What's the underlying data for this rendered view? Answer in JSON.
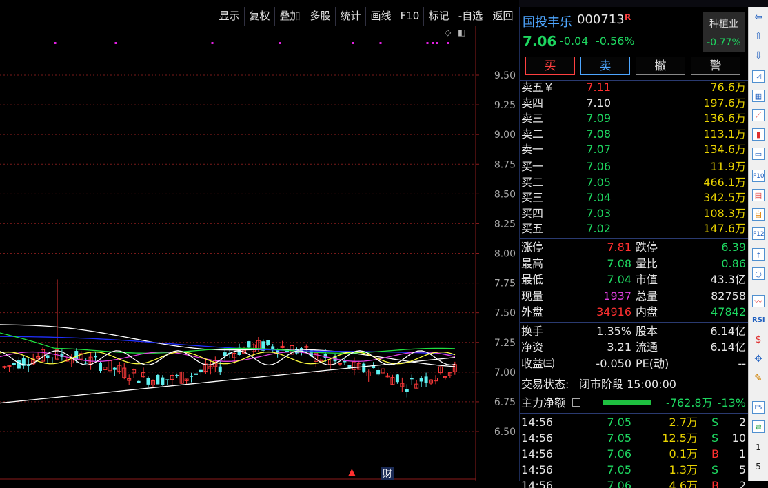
{
  "toolbar": {
    "buttons": [
      "显示",
      "复权",
      "叠加",
      "多股",
      "统计",
      "画线",
      "F10",
      "标记",
      "-自选",
      "返回"
    ]
  },
  "chart": {
    "y_ticks": [
      "9.50",
      "9.25",
      "9.00",
      "8.75",
      "8.50",
      "8.25",
      "8.00",
      "7.75",
      "7.50",
      "7.25",
      "7.00",
      "6.75",
      "6.50"
    ],
    "bottom_marks": {
      "arrow": "▲",
      "cai": "财"
    }
  },
  "chart_data": {
    "type": "candlestick",
    "ylim": [
      6.35,
      9.65
    ],
    "y_ticks": [
      9.5,
      9.25,
      9.0,
      8.75,
      8.5,
      8.25,
      8.0,
      7.75,
      7.5,
      7.25,
      7.0,
      6.75,
      6.5
    ]
  },
  "quote": {
    "name": "国投丰乐",
    "code": "000713",
    "badge": "R",
    "price": "7.06",
    "change": "-0.04",
    "change_pct": "-0.56%",
    "sector_name": "种植业",
    "sector_pct": "-0.77%"
  },
  "trade_buttons": {
    "buy": "买",
    "sell": "卖",
    "cancel": "撤",
    "alert": "警"
  },
  "asks": [
    {
      "label": "卖五￥",
      "price": "7.11",
      "vol": "76.6万"
    },
    {
      "label": "卖四",
      "price": "7.10",
      "vol": "197.6万"
    },
    {
      "label": "卖三",
      "price": "7.09",
      "vol": "136.6万"
    },
    {
      "label": "卖二",
      "price": "7.08",
      "vol": "113.1万"
    },
    {
      "label": "卖一",
      "price": "7.07",
      "vol": "134.6万"
    }
  ],
  "bids": [
    {
      "label": "买一",
      "price": "7.06",
      "vol": "11.9万"
    },
    {
      "label": "买二",
      "price": "7.05",
      "vol": "466.1万"
    },
    {
      "label": "买三",
      "price": "7.04",
      "vol": "342.5万"
    },
    {
      "label": "买四",
      "price": "7.03",
      "vol": "108.3万"
    },
    {
      "label": "买五",
      "price": "7.02",
      "vol": "147.6万"
    }
  ],
  "stats": [
    {
      "k1": "涨停",
      "v1": "7.81",
      "k2": "跌停",
      "v2": "6.39"
    },
    {
      "k1": "最高",
      "v1": "7.08",
      "k2": "量比",
      "v2": "0.86"
    },
    {
      "k1": "最低",
      "v1": "7.04",
      "k2": "市值",
      "v2": "43.3亿"
    },
    {
      "k1": "现量",
      "v1": "1937",
      "k2": "总量",
      "v2": "82758"
    },
    {
      "k1": "外盘",
      "v1": "34916",
      "k2": "内盘",
      "v2": "47842"
    }
  ],
  "fundamentals": [
    {
      "k1": "换手",
      "v1": "1.35%",
      "k2": "股本",
      "v2": "6.14亿"
    },
    {
      "k1": "净资",
      "v1": "3.21",
      "k2": "流通",
      "v2": "6.14亿"
    },
    {
      "k1": "收益㈢",
      "v1": "-0.050",
      "k2": "PE(动)",
      "v2": "--"
    }
  ],
  "status": {
    "label": "交易状态:",
    "value": "闭市阶段 15:00:00"
  },
  "main_flow": {
    "label": "主力净额",
    "value": "-762.8万",
    "pct": "-13%"
  },
  "ticks": [
    {
      "time": "14:56",
      "price": "7.05",
      "vol": "2.7万",
      "side": "S",
      "n": "2"
    },
    {
      "time": "14:56",
      "price": "7.05",
      "vol": "12.5万",
      "side": "S",
      "n": "10"
    },
    {
      "time": "14:56",
      "price": "7.06",
      "vol": "0.1万",
      "side": "B",
      "n": "1"
    },
    {
      "time": "14:56",
      "price": "7.05",
      "vol": "1.3万",
      "side": "S",
      "n": "5"
    },
    {
      "time": "14:56",
      "price": "7.06",
      "vol": "4.6万",
      "side": "B",
      "n": "2"
    }
  ],
  "side_icons": {
    "num1": "1",
    "num5": "5",
    "f10": "F10",
    "f12": "F12",
    "f5": "F5",
    "rsi": "RSI"
  }
}
